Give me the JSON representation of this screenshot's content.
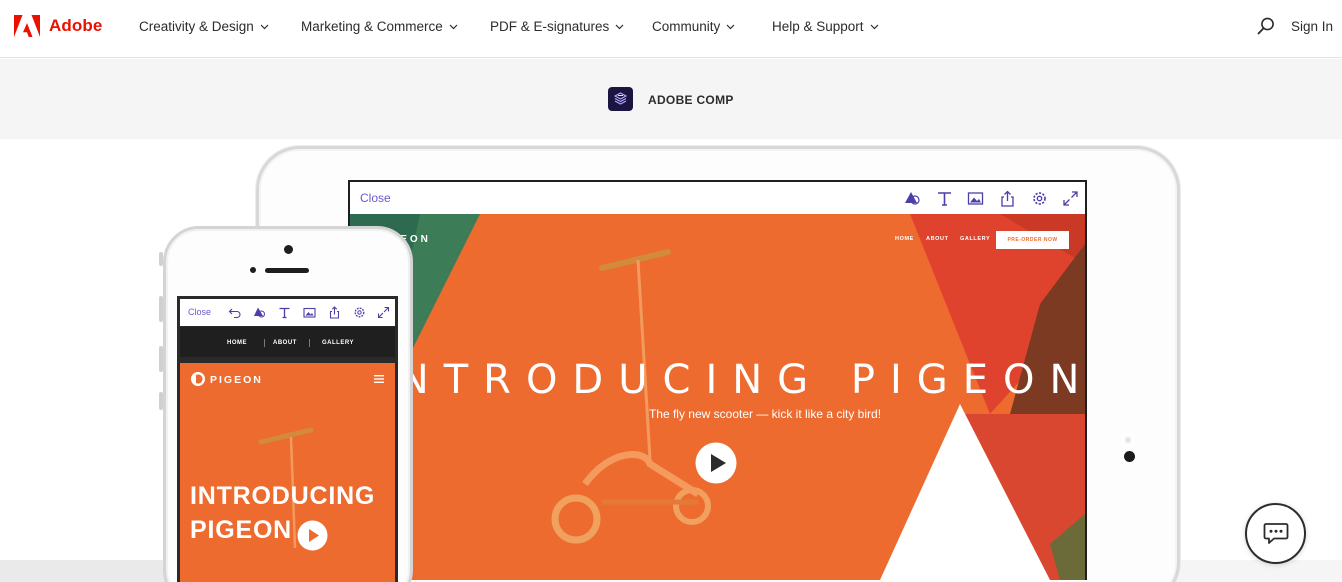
{
  "brand": {
    "name": "Adobe",
    "color": "#eb1000",
    "icon": "adobe-logo-icon"
  },
  "nav": {
    "items": [
      {
        "label": "Creativity & Design"
      },
      {
        "label": "Marketing & Commerce"
      },
      {
        "label": "PDF & E-signatures"
      },
      {
        "label": "Community"
      },
      {
        "label": "Help & Support"
      }
    ],
    "search_icon": "search-icon",
    "sign_in": "Sign In"
  },
  "subnav": {
    "product_title": "ADOBE COMP",
    "product_icon": "adobe-comp-icon"
  },
  "tablet_mockup": {
    "toolbar": {
      "close": "Close",
      "tools": [
        "shapes-icon",
        "text-icon",
        "image-icon",
        "share-icon",
        "settings-icon",
        "expand-icon"
      ]
    },
    "site": {
      "brand": "PIGEON",
      "links": [
        "HOME",
        "ABOUT",
        "GALLERY"
      ],
      "cta": "PRE-ORDER NOW",
      "headline": "INTRODUCING PIGEON",
      "subheadline": "The fly new scooter — kick it like a city bird!"
    }
  },
  "phone_mockup": {
    "toolbar": {
      "close": "Close",
      "tools": [
        "undo-icon",
        "shapes-icon",
        "text-icon",
        "image-icon",
        "share-icon",
        "settings-icon",
        "expand-icon"
      ]
    },
    "menu": [
      "HOME",
      "ABOUT",
      "GALLERY"
    ],
    "site": {
      "brand": "PIGEON",
      "headline_line1": "INTRODUCING",
      "headline_line2": "PIGEON"
    }
  },
  "colors": {
    "accent_orange": "#ee6b2f",
    "tool_purple": "#6a5acd",
    "comp_icon_bg": "#1b1541"
  },
  "chat_icon": "chat-icon"
}
